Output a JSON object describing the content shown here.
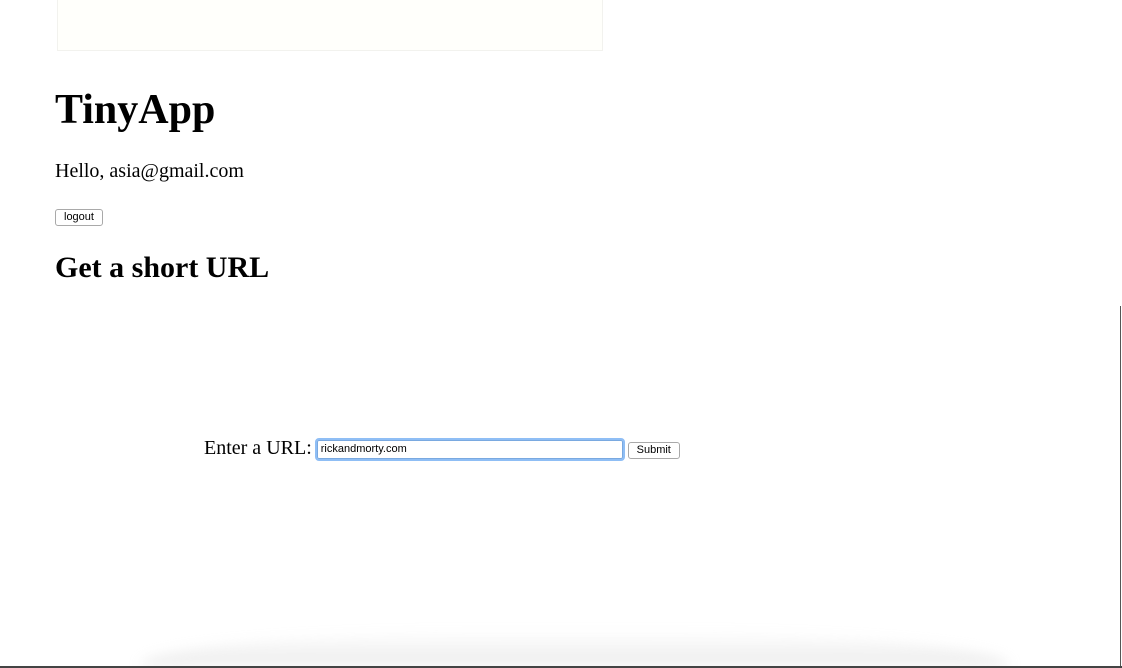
{
  "header": {
    "title": "TinyApp",
    "greeting": "Hello, asia@gmail.com",
    "logout_label": "logout"
  },
  "main": {
    "section_title": "Get a short URL",
    "form": {
      "label": "Enter a URL:",
      "input_value": "rickandmorty.com",
      "submit_label": "Submit"
    }
  }
}
